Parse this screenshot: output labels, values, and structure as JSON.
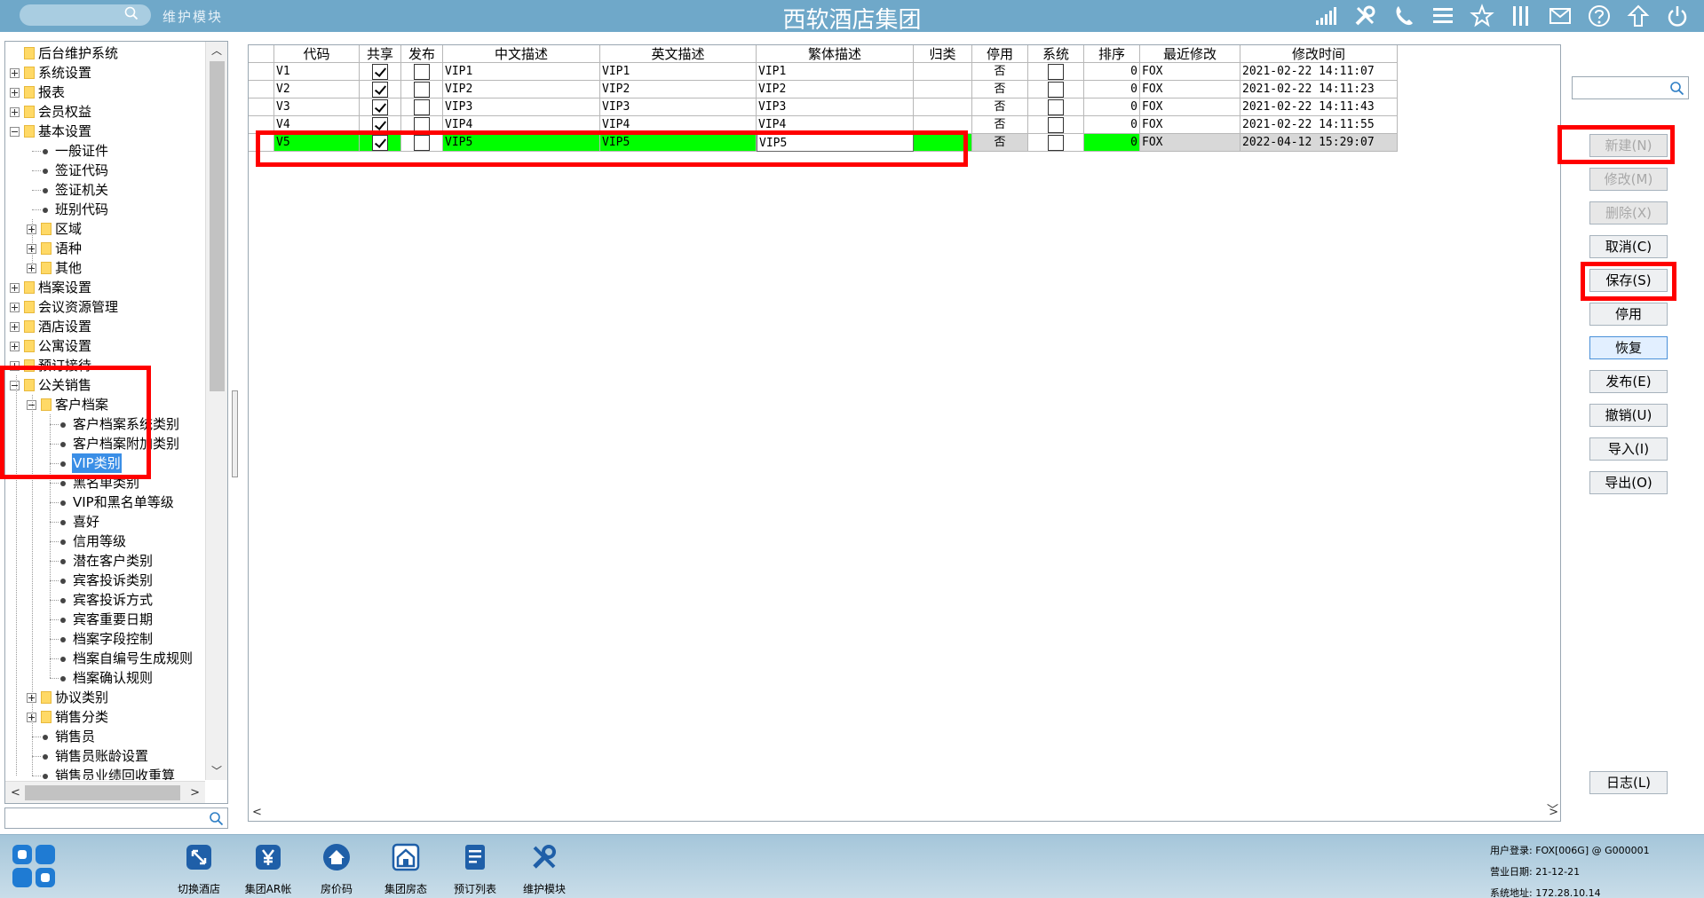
{
  "header": {
    "module_label": "维护模块",
    "app_title": "西软酒店集团",
    "icons": [
      "signal-icon",
      "tools-icon",
      "phone-icon",
      "menu-icon",
      "star-icon",
      "columns-icon",
      "mail-icon",
      "help-icon",
      "pin-icon",
      "power-icon"
    ]
  },
  "tree": {
    "nodes": [
      {
        "label": "后台维护系统",
        "level": 0,
        "kind": "folder",
        "expander": "none"
      },
      {
        "label": "系统设置",
        "level": 0,
        "kind": "folder",
        "expander": "plus"
      },
      {
        "label": "报表",
        "level": 0,
        "kind": "folder",
        "expander": "plus"
      },
      {
        "label": "会员权益",
        "level": 0,
        "kind": "folder",
        "expander": "plus"
      },
      {
        "label": "基本设置",
        "level": 0,
        "kind": "folder",
        "expander": "minus"
      },
      {
        "label": "一般证件",
        "level": 1,
        "kind": "leaf"
      },
      {
        "label": "签证代码",
        "level": 1,
        "kind": "leaf"
      },
      {
        "label": "签证机关",
        "level": 1,
        "kind": "leaf"
      },
      {
        "label": "班别代码",
        "level": 1,
        "kind": "leaf"
      },
      {
        "label": "区域",
        "level": 1,
        "kind": "folder",
        "expander": "plus"
      },
      {
        "label": "语种",
        "level": 1,
        "kind": "folder",
        "expander": "plus"
      },
      {
        "label": "其他",
        "level": 1,
        "kind": "folder",
        "expander": "plus"
      },
      {
        "label": "档案设置",
        "level": 0,
        "kind": "folder",
        "expander": "plus"
      },
      {
        "label": "会议资源管理",
        "level": 0,
        "kind": "folder",
        "expander": "plus"
      },
      {
        "label": "酒店设置",
        "level": 0,
        "kind": "folder",
        "expander": "plus"
      },
      {
        "label": "公寓设置",
        "level": 0,
        "kind": "folder",
        "expander": "plus"
      },
      {
        "label": "预订接待",
        "level": 0,
        "kind": "folder",
        "expander": "plus"
      },
      {
        "label": "公关销售",
        "level": 0,
        "kind": "folder",
        "expander": "minus"
      },
      {
        "label": "客户档案",
        "level": 1,
        "kind": "folder",
        "expander": "minus"
      },
      {
        "label": "客户档案系统类别",
        "level": 2,
        "kind": "leaf"
      },
      {
        "label": "客户档案附加类别",
        "level": 2,
        "kind": "leaf"
      },
      {
        "label": "VIP类别",
        "level": 2,
        "kind": "leaf",
        "selected": true
      },
      {
        "label": "黑名单类别",
        "level": 2,
        "kind": "leaf"
      },
      {
        "label": "VIP和黑名单等级",
        "level": 2,
        "kind": "leaf"
      },
      {
        "label": "喜好",
        "level": 2,
        "kind": "leaf"
      },
      {
        "label": "信用等级",
        "level": 2,
        "kind": "leaf"
      },
      {
        "label": "潜在客户类别",
        "level": 2,
        "kind": "leaf"
      },
      {
        "label": "宾客投诉类别",
        "level": 2,
        "kind": "leaf"
      },
      {
        "label": "宾客投诉方式",
        "level": 2,
        "kind": "leaf"
      },
      {
        "label": "宾客重要日期",
        "level": 2,
        "kind": "leaf"
      },
      {
        "label": "档案字段控制",
        "level": 2,
        "kind": "leaf"
      },
      {
        "label": "档案自编号生成规则",
        "level": 2,
        "kind": "leaf"
      },
      {
        "label": "档案确认规则",
        "level": 2,
        "kind": "leaf"
      },
      {
        "label": "协议类别",
        "level": 1,
        "kind": "folder",
        "expander": "plus"
      },
      {
        "label": "销售分类",
        "level": 1,
        "kind": "folder",
        "expander": "plus"
      },
      {
        "label": "销售员",
        "level": 1,
        "kind": "leaf"
      },
      {
        "label": "销售员账龄设置",
        "level": 1,
        "kind": "leaf"
      },
      {
        "label": "销售员业绩回收重算",
        "level": 1,
        "kind": "leaf"
      }
    ]
  },
  "grid": {
    "columns": [
      "代码",
      "共享",
      "发布",
      "中文描述",
      "英文描述",
      "繁体描述",
      "归类",
      "停用",
      "系统",
      "排序",
      "最近修改",
      "修改时间"
    ],
    "rows": [
      {
        "code": "V1",
        "share": true,
        "publish": false,
        "cn": "VIP1",
        "en": "VIP1",
        "tw": "VIP1",
        "cat": "",
        "disabled": "否",
        "system": false,
        "order": "0",
        "modifier": "FOX",
        "time": "2021-02-22 14:11:07",
        "active": false
      },
      {
        "code": "V2",
        "share": true,
        "publish": false,
        "cn": "VIP2",
        "en": "VIP2",
        "tw": "VIP2",
        "cat": "",
        "disabled": "否",
        "system": false,
        "order": "0",
        "modifier": "FOX",
        "time": "2021-02-22 14:11:23",
        "active": false
      },
      {
        "code": "V3",
        "share": true,
        "publish": false,
        "cn": "VIP3",
        "en": "VIP3",
        "tw": "VIP3",
        "cat": "",
        "disabled": "否",
        "system": false,
        "order": "0",
        "modifier": "FOX",
        "time": "2021-02-22 14:11:43",
        "active": false
      },
      {
        "code": "V4",
        "share": true,
        "publish": false,
        "cn": "VIP4",
        "en": "VIP4",
        "tw": "VIP4",
        "cat": "",
        "disabled": "否",
        "system": false,
        "order": "0",
        "modifier": "FOX",
        "time": "2021-02-22 14:11:55",
        "active": false
      },
      {
        "code": "V5",
        "share": true,
        "publish": false,
        "cn": "VIP5",
        "en": "VIP5",
        "tw": "VIP5",
        "cat": "",
        "disabled": "否",
        "system": false,
        "order": "0",
        "modifier": "FOX",
        "time": "2022-04-12 15:29:07",
        "active": true
      }
    ]
  },
  "actions": [
    {
      "name": "new-button",
      "label": "新建(N)",
      "disabled": true
    },
    {
      "name": "modify-button",
      "label": "修改(M)",
      "disabled": true
    },
    {
      "name": "delete-button",
      "label": "删除(X)",
      "disabled": true
    },
    {
      "name": "cancel-button",
      "label": "取消(C)",
      "disabled": false
    },
    {
      "name": "save-button",
      "label": "保存(S)",
      "disabled": false
    },
    {
      "name": "disable-button",
      "label": "停用",
      "disabled": false
    },
    {
      "name": "restore-button",
      "label": "恢复",
      "disabled": false,
      "hot": true
    },
    {
      "name": "publish-button",
      "label": "发布(E)",
      "disabled": false
    },
    {
      "name": "revoke-button",
      "label": "撤销(U)",
      "disabled": false
    },
    {
      "name": "import-button",
      "label": "导入(I)",
      "disabled": false
    },
    {
      "name": "export-button",
      "label": "导出(O)",
      "disabled": false
    }
  ],
  "log_button": "日志(L)",
  "taskbar": {
    "items": [
      {
        "label": "切换酒店",
        "icon": "switch-hotel-icon"
      },
      {
        "label": "集团AR帐",
        "icon": "yen-icon"
      },
      {
        "label": "房价码",
        "icon": "house-icon"
      },
      {
        "label": "集团房态",
        "icon": "room-status-icon"
      },
      {
        "label": "预订列表",
        "icon": "booking-list-icon"
      },
      {
        "label": "维护模块",
        "icon": "tools-icon"
      }
    ],
    "login_line": "用户登录: FOX[006G] @ G000001",
    "business_date_line": "营业日期: 21-12-21",
    "system_address_line": "系统地址: 172.28.10.14"
  },
  "colors": {
    "topbar": "#6fa8c9",
    "active_row": "#00ff00",
    "highlight_box": "#ff0000",
    "selected_tree": "#3a8ee6"
  }
}
